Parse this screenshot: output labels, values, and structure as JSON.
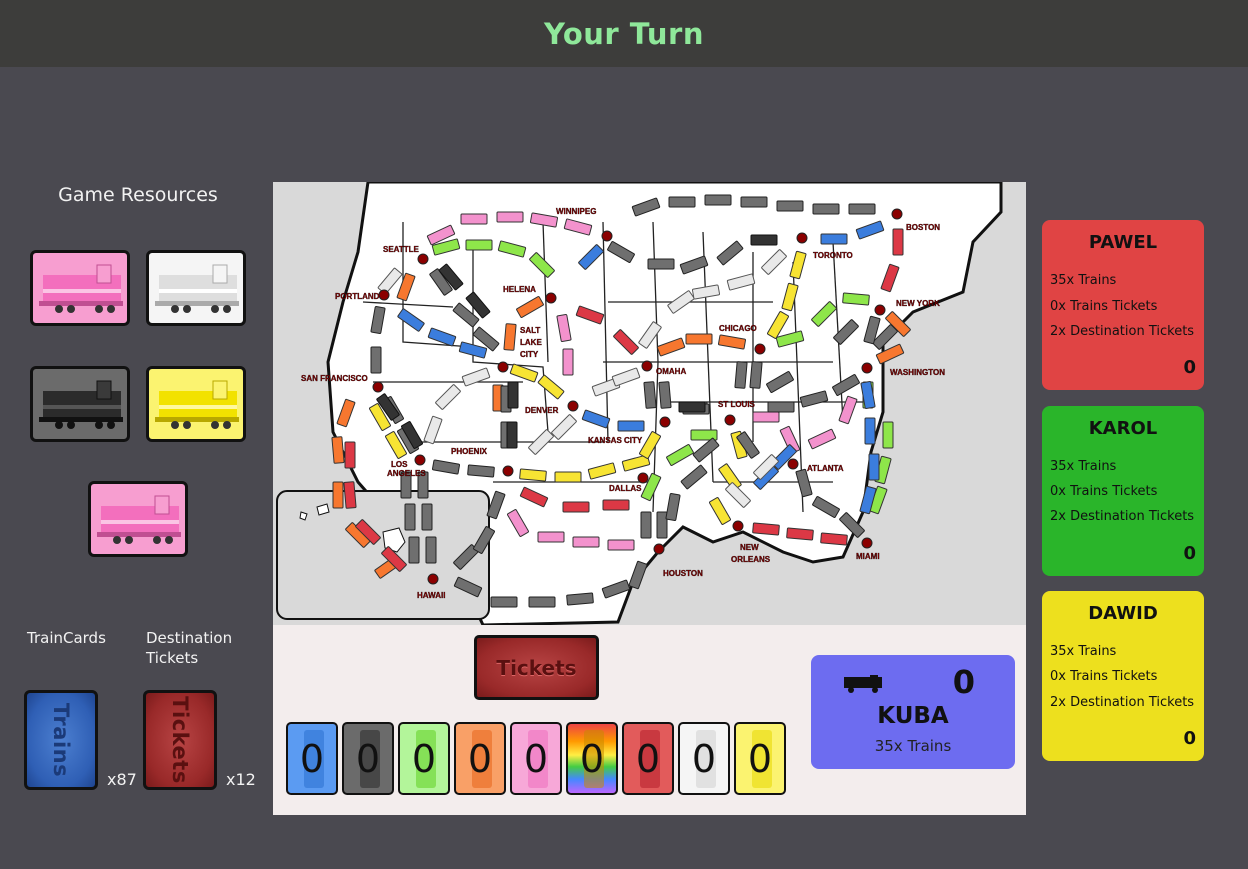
{
  "header": {
    "title": "Your Turn"
  },
  "resources": {
    "title": "Game Resources",
    "face_up_cards": [
      {
        "color": "pink",
        "hex": "#f79ed0"
      },
      {
        "color": "white",
        "hex": "#f5f5f5"
      },
      {
        "color": "black",
        "hex": "#6b6b6b"
      },
      {
        "color": "yellow",
        "hex": "#fbf370"
      },
      {
        "color": "pink",
        "hex": "#f79ed0"
      }
    ],
    "train_deck": {
      "label": "TrainCards",
      "card_text": "Trains",
      "count": "x87"
    },
    "ticket_deck": {
      "label": "Destination Tickets",
      "card_text": "Tickets",
      "count": "x12"
    }
  },
  "map": {
    "cities": [
      "SEATTLE",
      "PORTLAND",
      "SAN FRANCISCO",
      "LOS ANGELES",
      "HELENA",
      "SALT LAKE CITY",
      "WINNIPEG",
      "DENVER",
      "PHOENIX",
      "OMAHA",
      "KANSAS CITY",
      "DALLAS",
      "HOUSTON",
      "CHICAGO",
      "ST LOUIS",
      "TORONTO",
      "BOSTON",
      "NEW YORK",
      "WASHINGTON",
      "ATLANTA",
      "NEW ORLEANS",
      "MIAMI",
      "HAWAII"
    ]
  },
  "actions": {
    "tickets_button": "Tickets"
  },
  "hand": [
    {
      "color": "blue",
      "hex": "#5b9bf2",
      "count": "0"
    },
    {
      "color": "black",
      "hex": "#6b6b6b",
      "count": "0"
    },
    {
      "color": "green",
      "hex": "#b3f59a",
      "count": "0"
    },
    {
      "color": "orange",
      "hex": "#f9a067",
      "count": "0"
    },
    {
      "color": "pink",
      "hex": "#f7a8d8",
      "count": "0"
    },
    {
      "color": "locomotive",
      "hex": "rainbow",
      "count": "0"
    },
    {
      "color": "red",
      "hex": "#e25b5b",
      "count": "0"
    },
    {
      "color": "white",
      "hex": "#f5f5f5",
      "count": "0"
    },
    {
      "color": "yellow",
      "hex": "#fbf370",
      "count": "0"
    }
  ],
  "current_player": {
    "name": "KUBA",
    "score": "0",
    "trains": "35x Trains",
    "color": "#6d6cf0"
  },
  "opponents": [
    {
      "name": "PAWEL",
      "color": "#e04444",
      "trains": "35x Trains",
      "train_tickets": "0x Trains Tickets",
      "destination_tickets": "2x Destination Tickets",
      "score": "0"
    },
    {
      "name": "KAROL",
      "color": "#2ab52a",
      "trains": "35x Trains",
      "train_tickets": "0x Trains Tickets",
      "destination_tickets": "2x Destination Tickets",
      "score": "0"
    },
    {
      "name": "DAWID",
      "color": "#ede01e",
      "trains": "35x Trains",
      "train_tickets": "0x Trains Tickets",
      "destination_tickets": "2x Destination Tickets",
      "score": "0"
    }
  ]
}
